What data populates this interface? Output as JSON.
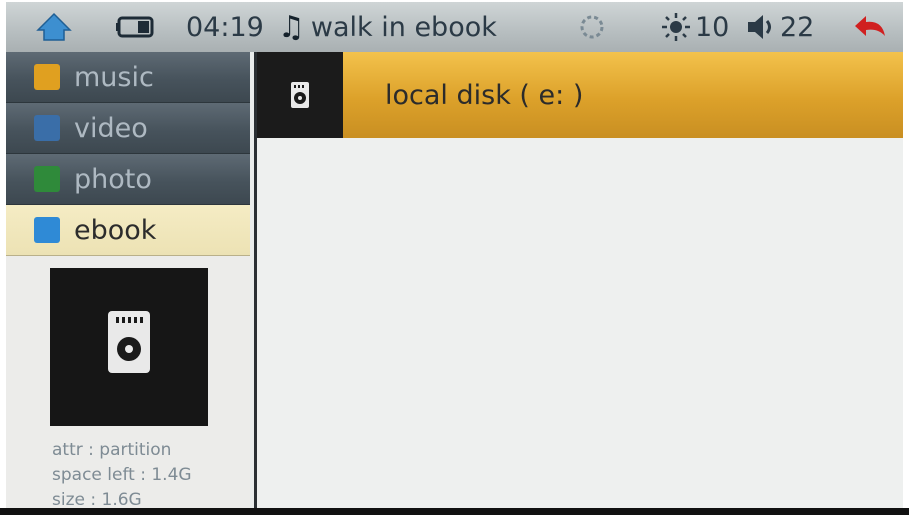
{
  "status_bar": {
    "time": "04:19",
    "now_playing": "walk in ebook",
    "brightness": "10",
    "volume": "22"
  },
  "sidebar": {
    "items": [
      {
        "label": "music",
        "icon": "music-icon",
        "color": "#e0a020"
      },
      {
        "label": "video",
        "icon": "film-icon",
        "color": "#3a6ea8"
      },
      {
        "label": "photo",
        "icon": "image-icon",
        "color": "#2f8a3a"
      },
      {
        "label": "ebook",
        "icon": "book-icon",
        "color": "#2f8ad6"
      }
    ],
    "active": "ebook"
  },
  "details": {
    "attr": "attr : partition",
    "space_left": "space left : 1.4G",
    "size": "size : 1.6G"
  },
  "main": {
    "items": [
      {
        "label": "local disk ( e: )",
        "icon": "disk-icon"
      }
    ]
  },
  "colors": {
    "accent": "#dca12a",
    "menu_bg": "#47535c",
    "active_bg": "#f0e6bc",
    "back_arrow": "#d02020"
  }
}
